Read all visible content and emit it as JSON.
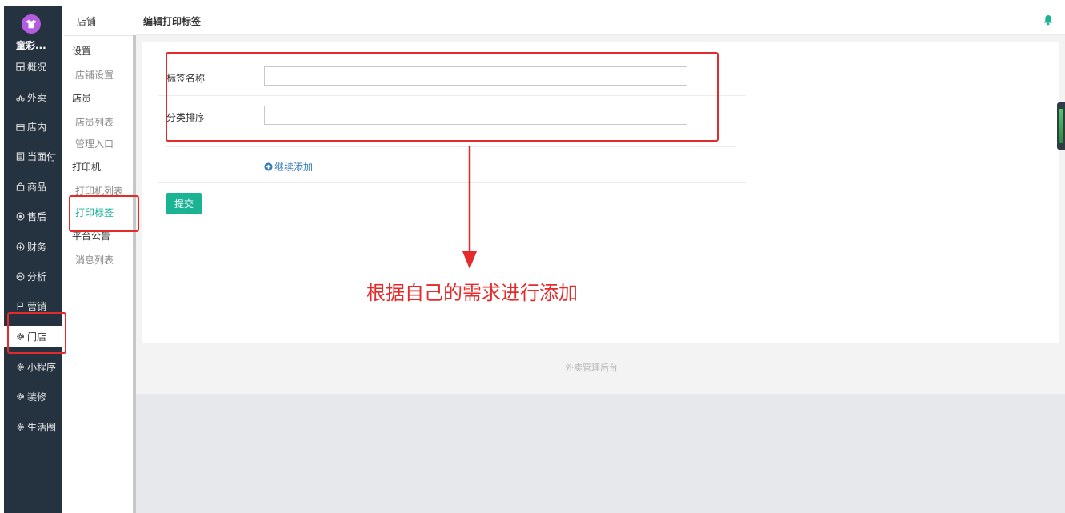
{
  "brand": {
    "name": "童彩..."
  },
  "nav": {
    "items": [
      {
        "label": "概况",
        "icon": "dashboard-icon"
      },
      {
        "label": "外卖",
        "icon": "delivery-icon"
      },
      {
        "label": "店内",
        "icon": "store-icon"
      },
      {
        "label": "当面付",
        "icon": "receipt-icon"
      },
      {
        "label": "商品",
        "icon": "bag-icon"
      },
      {
        "label": "售后",
        "icon": "service-icon"
      },
      {
        "label": "财务",
        "icon": "money-icon"
      },
      {
        "label": "分析",
        "icon": "analytics-icon"
      },
      {
        "label": "营销",
        "icon": "flag-icon"
      },
      {
        "label": "门店",
        "icon": "gear-icon"
      },
      {
        "label": "小程序",
        "icon": "gear-icon"
      },
      {
        "label": "装修",
        "icon": "gear-icon"
      },
      {
        "label": "生活圈",
        "icon": "gear-icon"
      }
    ],
    "active": "门店"
  },
  "subnav": {
    "title": "店铺",
    "groups": [
      {
        "label": "设置",
        "links": [
          "店铺设置"
        ]
      },
      {
        "label": "店员",
        "links": [
          "店员列表",
          "管理入口"
        ]
      },
      {
        "label": "打印机",
        "links": [
          "打印机列表",
          "打印标签"
        ]
      },
      {
        "label": "平台公告",
        "links": [
          "消息列表"
        ]
      }
    ],
    "active": "打印标签"
  },
  "topbar": {
    "title": "编辑打印标签"
  },
  "form": {
    "label_name": {
      "label": "标签名称",
      "value": ""
    },
    "sort": {
      "label": "分类排序",
      "value": ""
    },
    "add_more": "继续添加",
    "submit": "提交"
  },
  "footer": {
    "text": "外卖管理后台"
  },
  "annotation": {
    "text": "根据自己的需求进行添加"
  },
  "colors": {
    "sidebar": "#253341",
    "accent": "#1ab394",
    "annotation": "#e42a2a",
    "link": "#337ab7"
  }
}
